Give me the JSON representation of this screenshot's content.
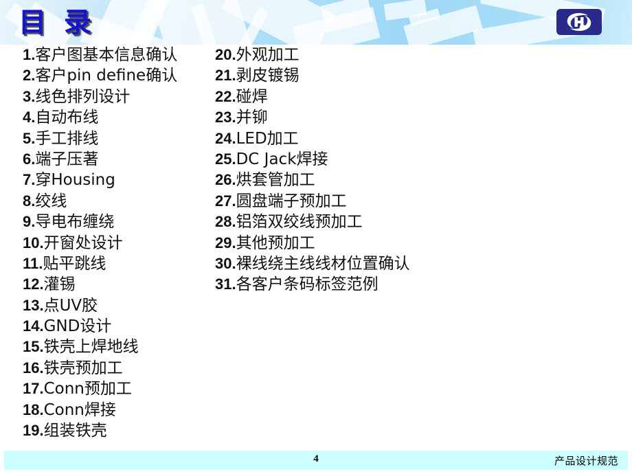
{
  "slide": {
    "title": "目 录",
    "logo": {
      "name": "company-logo",
      "letter": "H",
      "background_color": "#2a2a8c",
      "mark_color": "#ffffff"
    },
    "banner": {
      "accent_color": "#9ed8f6",
      "title_color": "#1414d2"
    }
  },
  "toc": {
    "left_column": [
      {
        "num": "1.",
        "text": "客户图基本信息确认"
      },
      {
        "num": "2.",
        "text": "客户pin define确认"
      },
      {
        "num": "3.",
        "text": "线色排列设计"
      },
      {
        "num": "4.",
        "text": "自动布线"
      },
      {
        "num": "5.",
        "text": "手工排线"
      },
      {
        "num": "6.",
        "text": "端子压著"
      },
      {
        "num": "7.",
        "text": "穿Housing"
      },
      {
        "num": "8.",
        "text": "绞线"
      },
      {
        "num": "9.",
        "text": "导电布缠绕"
      },
      {
        "num": "10.",
        "text": "开窗处设计"
      },
      {
        "num": "11.",
        "text": "贴平跳线"
      },
      {
        "num": "12.",
        "text": "灌锡"
      },
      {
        "num": "13.",
        "text": "点UV胶"
      },
      {
        "num": "14.",
        "text": "GND设计"
      },
      {
        "num": "15.",
        "text": "铁壳上焊地线"
      },
      {
        "num": "16.",
        "text": "铁壳预加工"
      },
      {
        "num": "17.",
        "text": "Conn预加工"
      },
      {
        "num": "18.",
        "text": "Conn焊接"
      },
      {
        "num": "19.",
        "text": "组装铁壳"
      }
    ],
    "right_column": [
      {
        "num": "20.",
        "text": "外观加工"
      },
      {
        "num": "21.",
        "text": "剥皮镀锡"
      },
      {
        "num": "22.",
        "text": "碰焊"
      },
      {
        "num": "23.",
        "text": "并铆"
      },
      {
        "num": "24.",
        "text": "LED加工"
      },
      {
        "num": "25.",
        "text": "DC Jack焊接"
      },
      {
        "num": "26.",
        "text": "烘套管加工"
      },
      {
        "num": "27.",
        "text": "圆盘端子预加工"
      },
      {
        "num": "28.",
        "text": "铝箔双绞线预加工"
      },
      {
        "num": "29.",
        "text": "其他预加工"
      },
      {
        "num": "30.",
        "text": "裸线绕主线线材位置确认"
      },
      {
        "num": "31.",
        "text": "各客户条码标签范例"
      }
    ]
  },
  "footer": {
    "page_number": "4",
    "document_title": "产品设计规范",
    "background_color": "#ccffff"
  }
}
